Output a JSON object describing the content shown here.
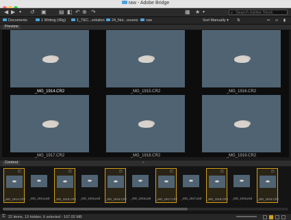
{
  "window": {
    "title": "raw - Adobe Bridge"
  },
  "toolbar": {
    "search_placeholder": "Search Adobe Stock",
    "sort_label": "Sort Manually"
  },
  "path": {
    "crumbs": [
      "Documents",
      "1 Writing (40g)",
      "1_TEC...volution",
      "24_Noi...osures",
      "raw"
    ]
  },
  "panels": {
    "preview_tab": "Preview",
    "content_tab": "Content"
  },
  "preview": {
    "items": [
      {
        "label": "_MG_1914.CR2",
        "selected": true
      },
      {
        "label": "_MG_1915.CR2",
        "selected": false
      },
      {
        "label": "_MG_1916.CR2",
        "selected": false
      },
      {
        "label": "_MG_1917.CR2",
        "selected": false
      },
      {
        "label": "_MG_1918.CR2",
        "selected": false
      },
      {
        "label": "_MG_1919.CR2",
        "selected": false
      }
    ],
    "rating_dots": "• • • • •"
  },
  "content": {
    "items": [
      {
        "label": "_MG_1914.CR2",
        "selected": true
      },
      {
        "label": "_MG_1914.psd",
        "selected": false
      },
      {
        "label": "_MG_1915.CR2",
        "selected": true
      },
      {
        "label": "_MG_1915.psd",
        "selected": false
      },
      {
        "label": "_MG_1916.CR2",
        "selected": true
      },
      {
        "label": "_MG_1916.psd",
        "selected": false
      },
      {
        "label": "_MG_1917.CR2",
        "selected": true
      },
      {
        "label": "_MG_1917.psd",
        "selected": false
      },
      {
        "label": "_MG_1918.CR2",
        "selected": true
      },
      {
        "label": "_MG_1918.psd",
        "selected": false
      },
      {
        "label": "_MG_1919.CR2",
        "selected": true
      }
    ]
  },
  "status": {
    "text": "22 items, 13 hidden, 6 selected - 107.02 MB"
  },
  "colors": {
    "accent": "#d4a017",
    "folder": "#4aa3df",
    "photo_bg": "#506373"
  }
}
